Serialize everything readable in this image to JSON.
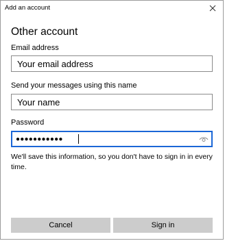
{
  "window": {
    "title": "Add an account"
  },
  "heading": "Other account",
  "email": {
    "label": "Email address",
    "value": "Your email address"
  },
  "name": {
    "label": "Send your messages using this name",
    "value": "Your name"
  },
  "password": {
    "label": "Password",
    "value": "●●●●●●●●●●●"
  },
  "note": "We'll save this information, so you don't have to sign in in every time.",
  "buttons": {
    "cancel": "Cancel",
    "sign_in": "Sign in"
  },
  "colors": {
    "focus_border": "#1a66d6",
    "button_bg": "#cccccc"
  },
  "icons": {
    "close": "close-icon",
    "reveal": "eye-icon"
  }
}
